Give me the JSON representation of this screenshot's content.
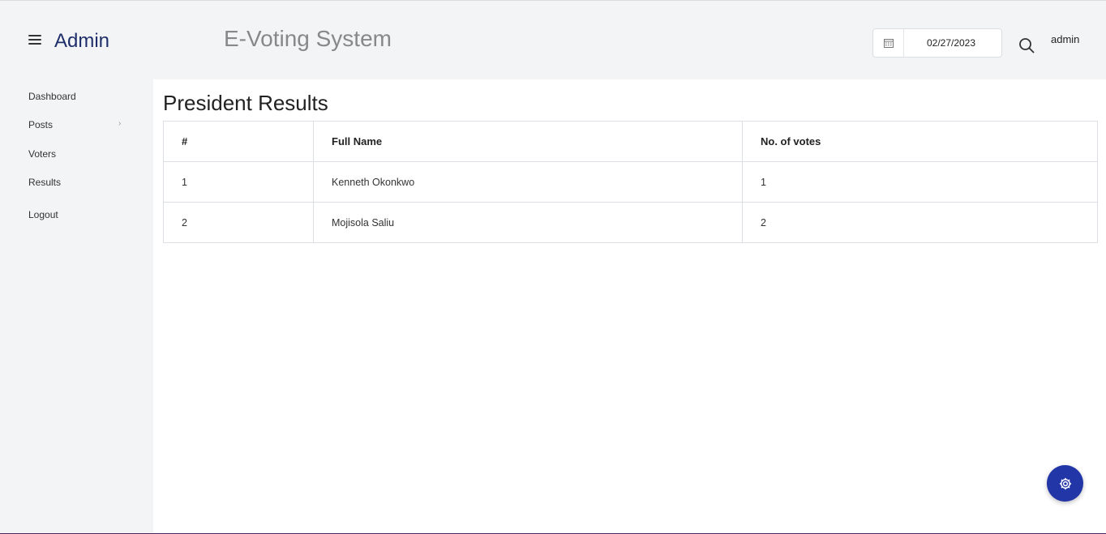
{
  "header": {
    "brand": "Admin",
    "app_title": "E-Voting System",
    "date_value": "02/27/2023",
    "user_name": "admin"
  },
  "sidebar": {
    "items": [
      {
        "label": "Dashboard"
      },
      {
        "label": "Posts",
        "has_submenu": true
      },
      {
        "label": "Voters"
      },
      {
        "label": "Results"
      },
      {
        "label": "Logout"
      }
    ],
    "submenu_arrow": "›"
  },
  "main": {
    "title": "President Results",
    "table": {
      "headers": [
        "#",
        "Full Name",
        "No. of votes"
      ],
      "rows": [
        [
          "1",
          "Kenneth Okonkwo",
          "1"
        ],
        [
          "2",
          "Mojisola Saliu",
          "2"
        ]
      ]
    }
  },
  "icons": {
    "menu": "hamburger-icon",
    "calendar": "calendar-icon",
    "search": "search-icon",
    "settings": "gear-icon"
  },
  "colors": {
    "brand": "#1f2f6b",
    "fab": "#2236a8",
    "background": "#f3f4f6"
  }
}
